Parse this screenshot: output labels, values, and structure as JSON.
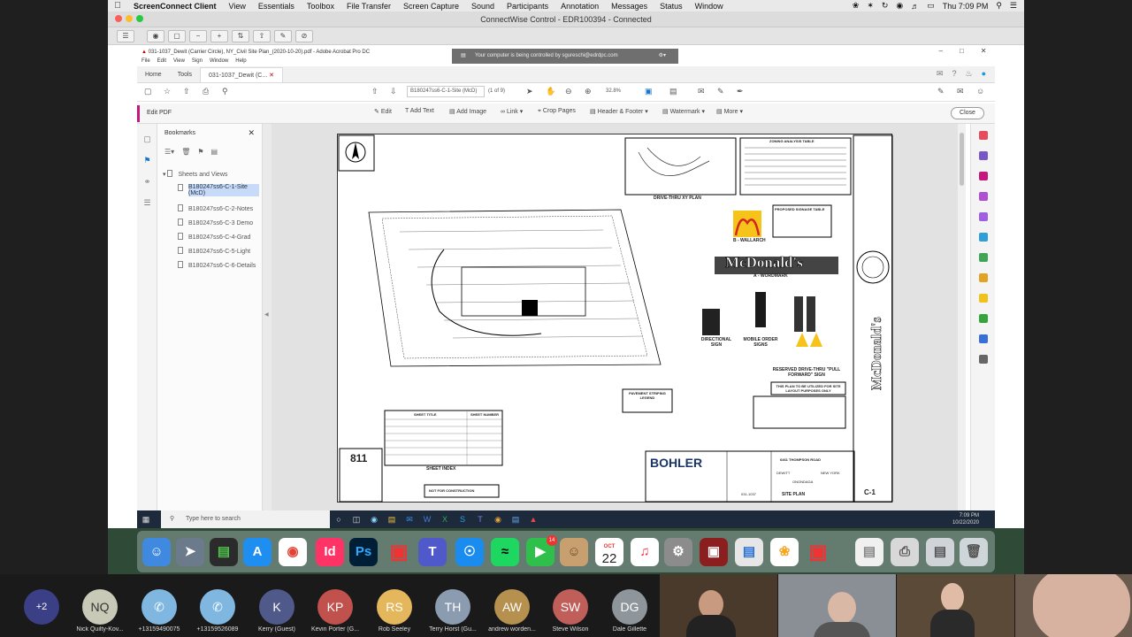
{
  "mac_menu": {
    "app": "ScreenConnect Client",
    "items": [
      "View",
      "Essentials",
      "Toolbox",
      "File Transfer",
      "Screen Capture",
      "Sound",
      "Participants",
      "Annotation",
      "Messages",
      "Status",
      "Window"
    ],
    "clock": "Thu 7:09 PM"
  },
  "screenconnect": {
    "title": "ConnectWise Control - EDR100394 - Connected"
  },
  "acrobat": {
    "window_title": "031-1037_Dewit (Carrier Circle), NY_Civil Site Plan_(2020-10-20).pdf - Adobe Acrobat Pro DC",
    "menu": [
      "File",
      "Edit",
      "View",
      "Sign",
      "Window",
      "Help"
    ],
    "control_banner": "Your computer is being controlled by sgureschi@edrdpc.com",
    "tabs": [
      "Home",
      "Tools",
      "031-1037_Dewit (C..."
    ],
    "page_label": "B180247ss6-C-1-Site (McD)",
    "page_count": "(1 of 9)",
    "zoom": "32.8%",
    "edit_pdf": "Edit PDF",
    "edit_tools": [
      "Edit",
      "Add Text",
      "Add Image",
      "Link",
      "Crop Pages",
      "Header & Footer",
      "Watermark",
      "More"
    ],
    "close": "Close"
  },
  "bookmarks": {
    "header": "Bookmarks",
    "root": "Sheets and Views",
    "items": [
      {
        "label": "B180247ss6-C-1-Site (McD)",
        "selected": true
      },
      {
        "label": "B180247ss6-C-2-Notes"
      },
      {
        "label": "B180247ss6-C-3 Demo"
      },
      {
        "label": "B180247ss6-C-4-Grad"
      },
      {
        "label": "B180247ss6-C-5-Light"
      },
      {
        "label": "B180247ss6-C-6-Details"
      }
    ]
  },
  "sheet": {
    "drive_thru_plan": "DRIVE-THRU XY PLAN",
    "zoning_table": "ZONING ANALYSIS TABLE",
    "signage_table": "PROPOSED SIGNAGE TABLE",
    "b_wallarch": "B - WALLARCH",
    "wordmark": "McDonald's",
    "a_wordmark": "A - WORDMARK",
    "directional_sign": "DIRECTIONAL SIGN",
    "mobile_order": "MOBILE ORDER SIGNS",
    "reserved": "RESERVED DRIVE-THRU \"PULL FORWARD\" SIGN",
    "plan_note": "THIS PLAN TO BE UTILIZED FOR SITE LAYOUT PURPOSES ONLY",
    "pavement": "PAVEMENT STRIPING LEGEND",
    "sheet_index": "SHEET INDEX",
    "sheet_title_col": "SHEET TITLE",
    "sheet_number_col": "SHEET NUMBER",
    "not_for_construction": "NOT FOR CONSTRUCTION",
    "bohler": "BOHLER",
    "address": "6461 THOMPSON ROAD",
    "town": "DEWITT",
    "county": "ONONDAGA",
    "state": "NEW YORK",
    "sheet_name": "SITE PLAN",
    "sheet_no": "C-1",
    "project_no": "031-1037",
    "side_logo": "McDonald's",
    "call811": "811"
  },
  "taskbar": {
    "search": "Type here to search",
    "time": "7:09 PM",
    "date": "10/22/2020"
  },
  "dock": {
    "calendar_month": "OCT",
    "calendar_day": "22",
    "facetime_badge": "14"
  },
  "zoom": {
    "participants": [
      {
        "initials": "+2",
        "name": "",
        "color": "#3b3f86"
      },
      {
        "initials": "NQ",
        "name": "Nick Quilty-Kov...",
        "color": "#c9c9b8"
      },
      {
        "initials": "",
        "name": "+13159490075",
        "color": "#7fb7e0"
      },
      {
        "initials": "",
        "name": "+13159526089",
        "color": "#7fb7e0"
      },
      {
        "initials": "K",
        "name": "Kerry (Guest)",
        "color": "#4f5a8a"
      },
      {
        "initials": "KP",
        "name": "Kevin Porter (G...",
        "color": "#c0514d"
      },
      {
        "initials": "RS",
        "name": "Rob Seeley",
        "color": "#e4b75d"
      },
      {
        "initials": "TH",
        "name": "Terry Horst (Gu...",
        "color": "#8b9bb0"
      },
      {
        "initials": "AW",
        "name": "andrew worden...",
        "color": "#b5904e"
      },
      {
        "initials": "SW",
        "name": "Steve Wilson",
        "color": "#c05e5a"
      },
      {
        "initials": "DG",
        "name": "Dale Gillette",
        "color": "#8e969c"
      }
    ]
  }
}
